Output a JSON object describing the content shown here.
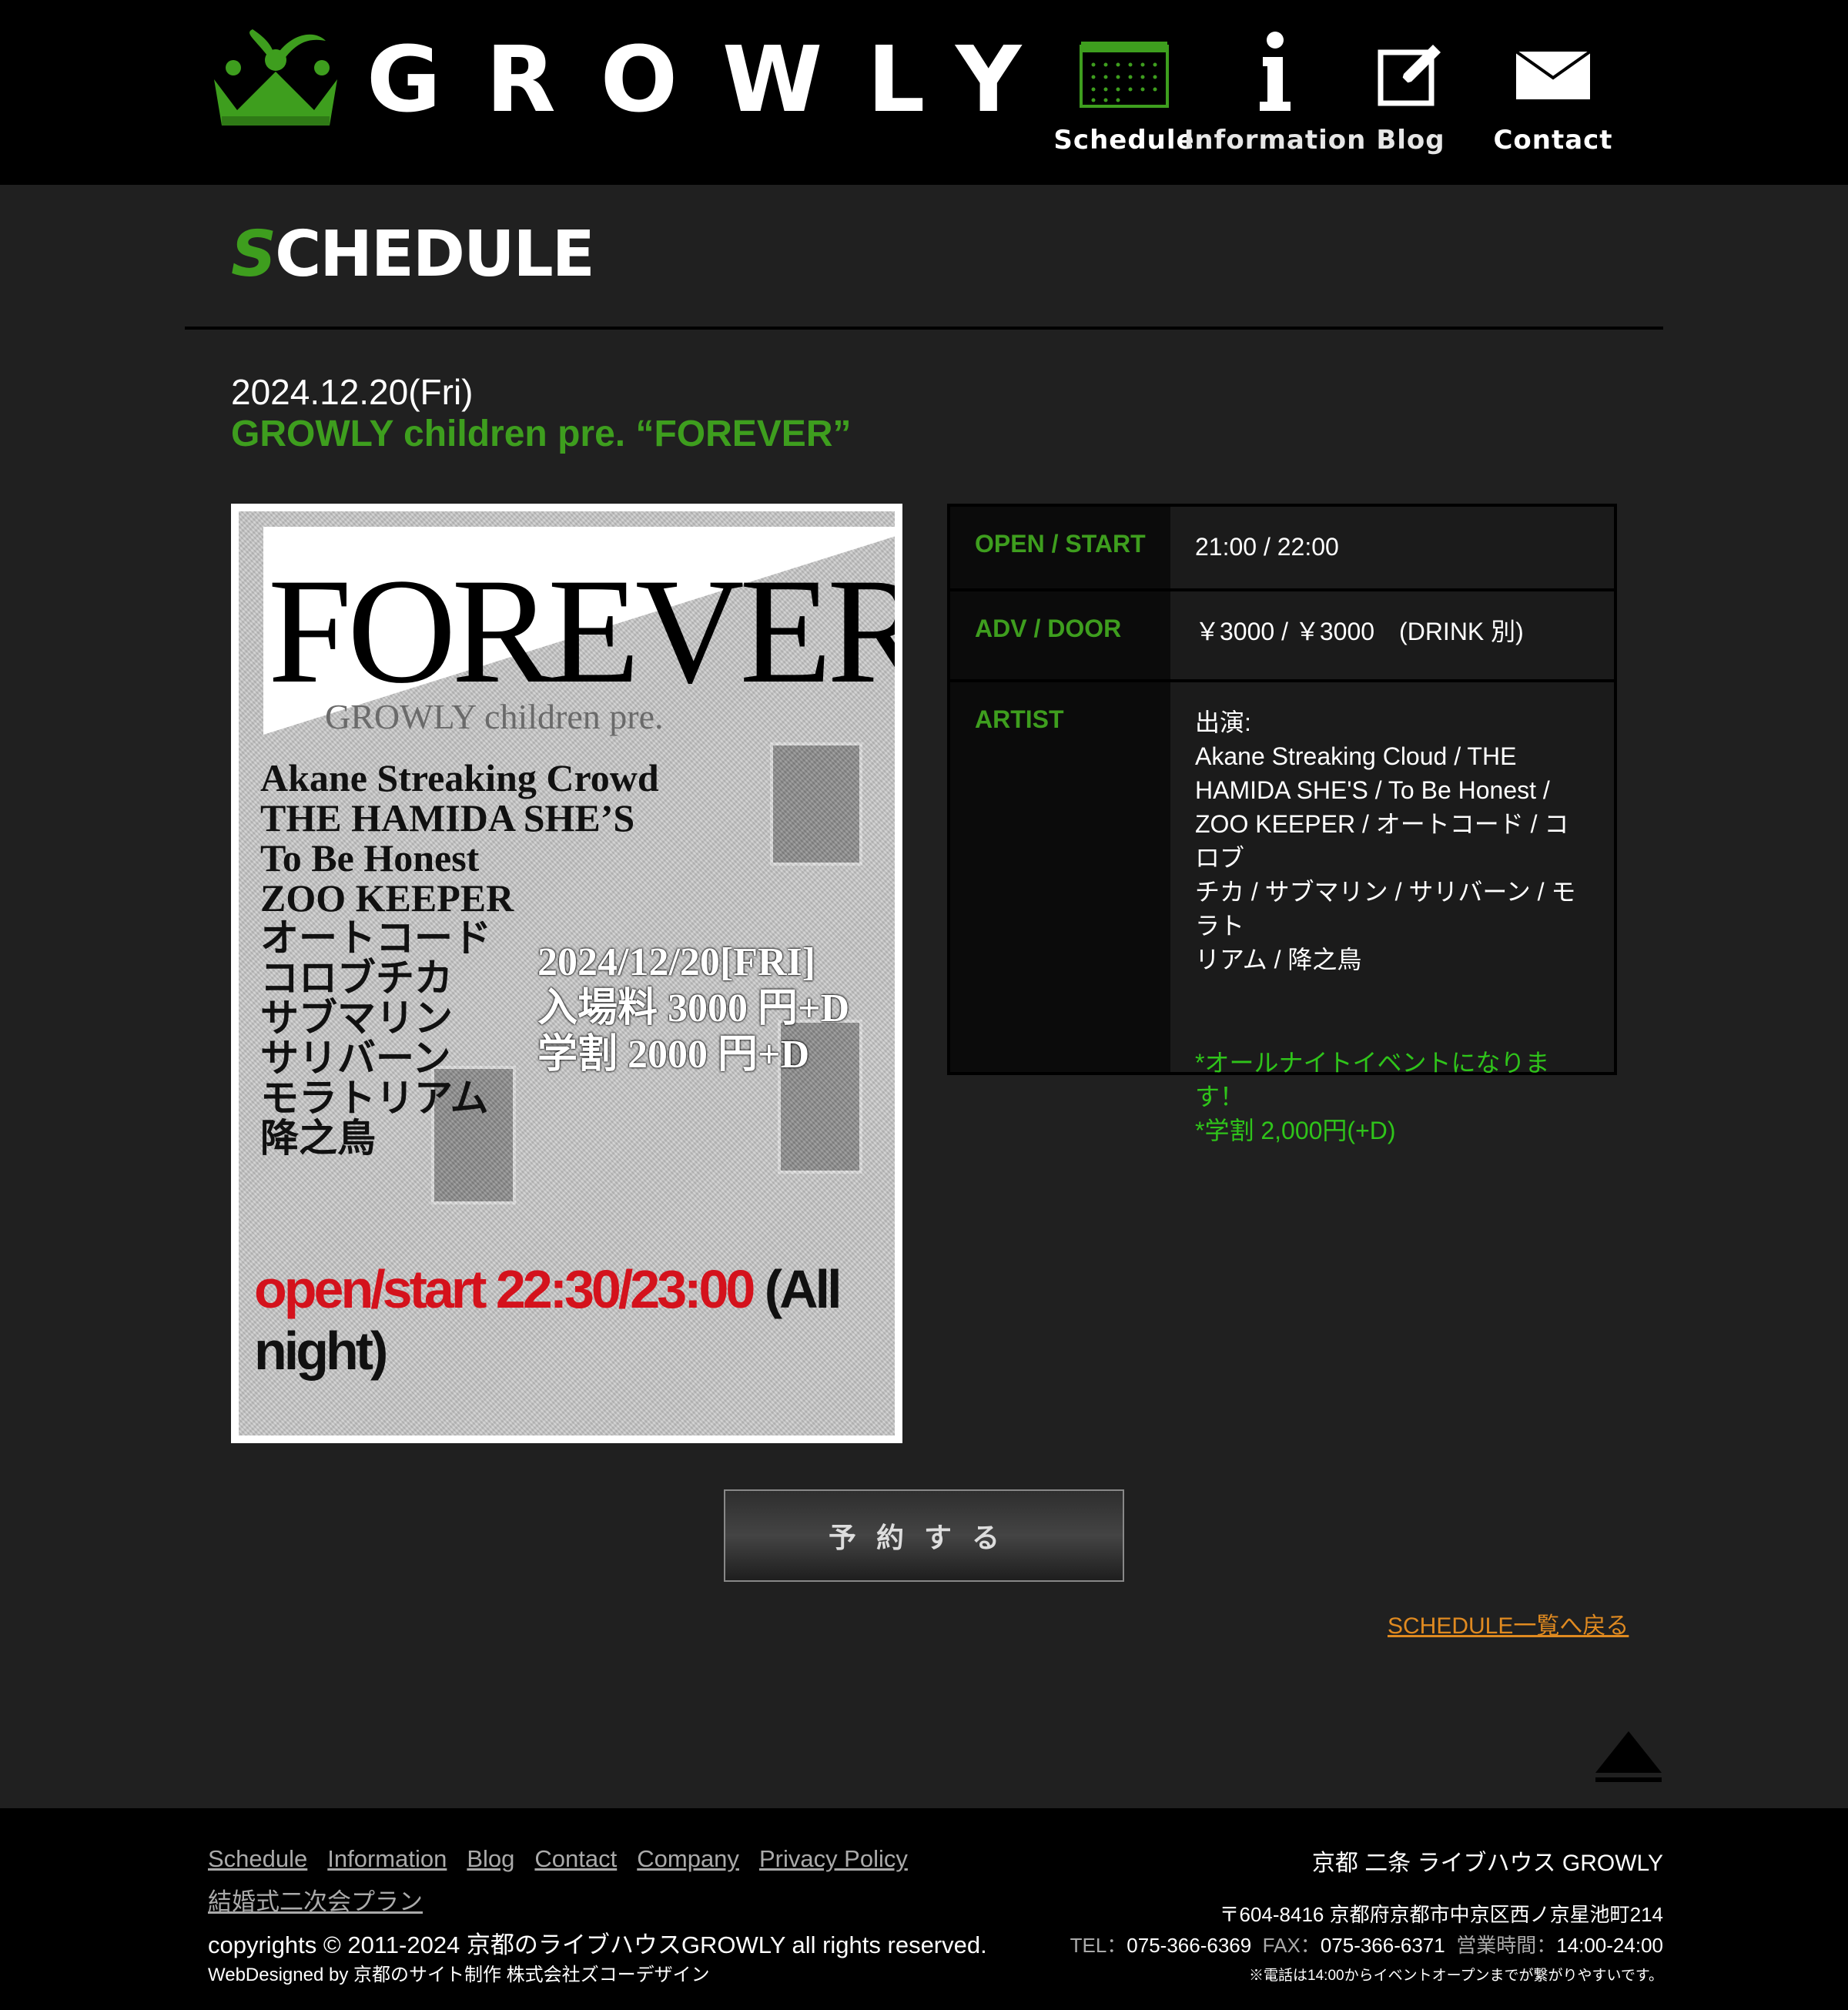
{
  "logo": {
    "text": "GROWLY"
  },
  "nav": [
    {
      "label": "Schedule",
      "icon": "calendar-icon"
    },
    {
      "label": "Information",
      "icon": "info-icon"
    },
    {
      "label": "Blog",
      "icon": "edit-icon"
    },
    {
      "label": "Contact",
      "icon": "mail-icon"
    }
  ],
  "section": {
    "title_first": "S",
    "title_rest": "CHEDULE"
  },
  "event": {
    "date": "2024.12.20(Fri)",
    "title": "GROWLY children pre. “FOREVER”"
  },
  "flyer": {
    "big_title": "FOREVER",
    "subtitle": "GROWLY children pre.",
    "artists": [
      "Akane Streaking Crowd",
      "THE HAMIDA SHE’S",
      "To Be Honest",
      "ZOO KEEPER",
      "オートコード",
      "コロブチカ",
      "サブマリン",
      "サリバーン",
      "モラトリアム",
      "降之鳥"
    ],
    "date": "2024/12/20[FRI]",
    "entry": "入場料 3000 円+D",
    "student": "学割 2000 円+D",
    "open_start": "open/start 22:30/23:00",
    "allnight": " (All night)"
  },
  "info": {
    "open_label": "OPEN / START",
    "open_value": "21:00 / 22:00",
    "adv_label": "ADV / DOOR",
    "adv_value": "￥3000 / ￥3000　(DRINK 別)",
    "artist_label": "ARTIST",
    "artist_intro": "出演:",
    "artist_lines": [
      "Akane Streaking Cloud / THE",
      "HAMIDA SHE'S / To Be Honest /",
      "ZOO KEEPER / オートコード / コロブ",
      "チカ / サブマリン / サリバーン / モラト",
      "リアム / 降之鳥"
    ],
    "note1": "*オールナイトイベントになります！",
    "note2": "*学割 2,000円(+D)"
  },
  "reserve_label": "予約する",
  "back_link": "SCHEDULE一覧へ戻る",
  "footer": {
    "links": [
      "Schedule",
      "Information",
      "Blog",
      "Contact",
      "Company",
      "Privacy Policy",
      "結婚式二次会プラン"
    ],
    "copyright": "copyrights © 2011-2024 京都のライブハウスGROWLY all rights reserved.",
    "webdesigned": "WebDesigned by 京都のサイト制作 株式会社ズコーデザイン",
    "venue_name": "京都 二条 ライブハウス GROWLY",
    "address": "〒604-8416 京都府京都市中京区西ノ京星池町214",
    "tel_label": "TEL：",
    "tel": "075-366-6369",
    "fax_label": "FAX：",
    "fax": "075-366-6371",
    "hours_label": "営業時間：",
    "hours": "14:00-24:00",
    "phone_note": "※電話は14:00からイベントオープンまでが繋がりやすいです。"
  },
  "colors": {
    "accent_green": "#3e9e1e",
    "note_green": "#2fc41a",
    "link_orange": "#e08a20"
  }
}
